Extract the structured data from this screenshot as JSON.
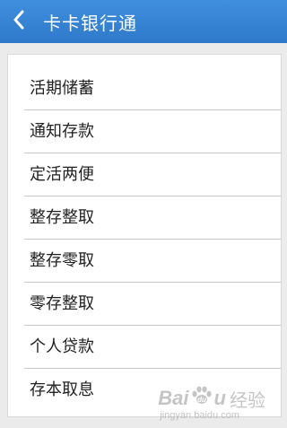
{
  "header": {
    "title": "卡卡银行通",
    "background": "#3584d5",
    "back_icon": "chevron-left-icon"
  },
  "menu": {
    "items": [
      {
        "label": "活期储蓄"
      },
      {
        "label": "通知存款"
      },
      {
        "label": "定活两便"
      },
      {
        "label": "整存整取"
      },
      {
        "label": "整存零取"
      },
      {
        "label": "零存整取"
      },
      {
        "label": "个人贷款"
      },
      {
        "label": "存本取息"
      }
    ]
  },
  "watermark": {
    "brand_left": "Bai",
    "brand_right": "u",
    "brand_cn": "经验",
    "url": "jingyan.baidu.com"
  }
}
